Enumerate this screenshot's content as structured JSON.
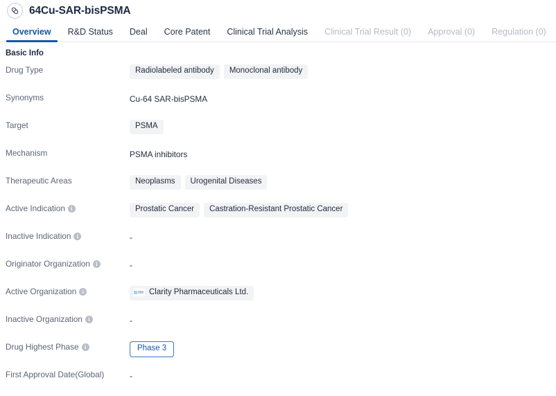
{
  "header": {
    "icon": "capsule-pill-icon",
    "title": "64Cu-SAR-bisPSMA"
  },
  "tabs": [
    {
      "label": "Overview",
      "state": "active"
    },
    {
      "label": "R&D Status",
      "state": "normal"
    },
    {
      "label": "Deal",
      "state": "normal"
    },
    {
      "label": "Core Patent",
      "state": "normal"
    },
    {
      "label": "Clinical Trial Analysis",
      "state": "normal"
    },
    {
      "label": "Clinical Trial Result (0)",
      "state": "disabled"
    },
    {
      "label": "Approval (0)",
      "state": "disabled"
    },
    {
      "label": "Regulation (0)",
      "state": "disabled"
    }
  ],
  "section": {
    "title": "Basic Info"
  },
  "rows": [
    {
      "label": "Drug Type",
      "info": false,
      "type": "chips",
      "chips": [
        "Radiolabeled antibody",
        "Monoclonal antibody"
      ]
    },
    {
      "label": "Synonyms",
      "info": false,
      "type": "text",
      "text": "Cu-64 SAR-bisPSMA"
    },
    {
      "label": "Target",
      "info": false,
      "type": "chips",
      "chips": [
        "PSMA"
      ]
    },
    {
      "label": "Mechanism",
      "info": false,
      "type": "text",
      "text": "PSMA inhibitors"
    },
    {
      "label": "Therapeutic Areas",
      "info": false,
      "type": "chips",
      "chips": [
        "Neoplasms",
        "Urogenital Diseases"
      ]
    },
    {
      "label": "Active Indication",
      "info": true,
      "type": "chips",
      "chips": [
        "Prostatic Cancer",
        "Castration-Resistant Prostatic Cancer"
      ]
    },
    {
      "label": "Inactive Indication",
      "info": true,
      "type": "text",
      "text": "-"
    },
    {
      "label": "Originator Organization",
      "info": true,
      "type": "text",
      "text": "-"
    },
    {
      "label": "Active Organization",
      "info": true,
      "type": "org",
      "org_name": "Clarity Pharmaceuticals Ltd."
    },
    {
      "label": "Inactive Organization",
      "info": true,
      "type": "text",
      "text": "-"
    },
    {
      "label": "Drug Highest Phase",
      "info": true,
      "type": "phase",
      "phase": "Phase 3"
    },
    {
      "label": "First Approval Date(Global)",
      "info": false,
      "type": "text",
      "text": "-"
    }
  ],
  "colors": {
    "accent": "#1558a8",
    "label_text": "#5b6576",
    "value_text": "#1f2a3a",
    "chip_bg": "#f2f3f5",
    "disabled_tab": "#b3bbc7",
    "phase_border": "#2f7dc4"
  }
}
